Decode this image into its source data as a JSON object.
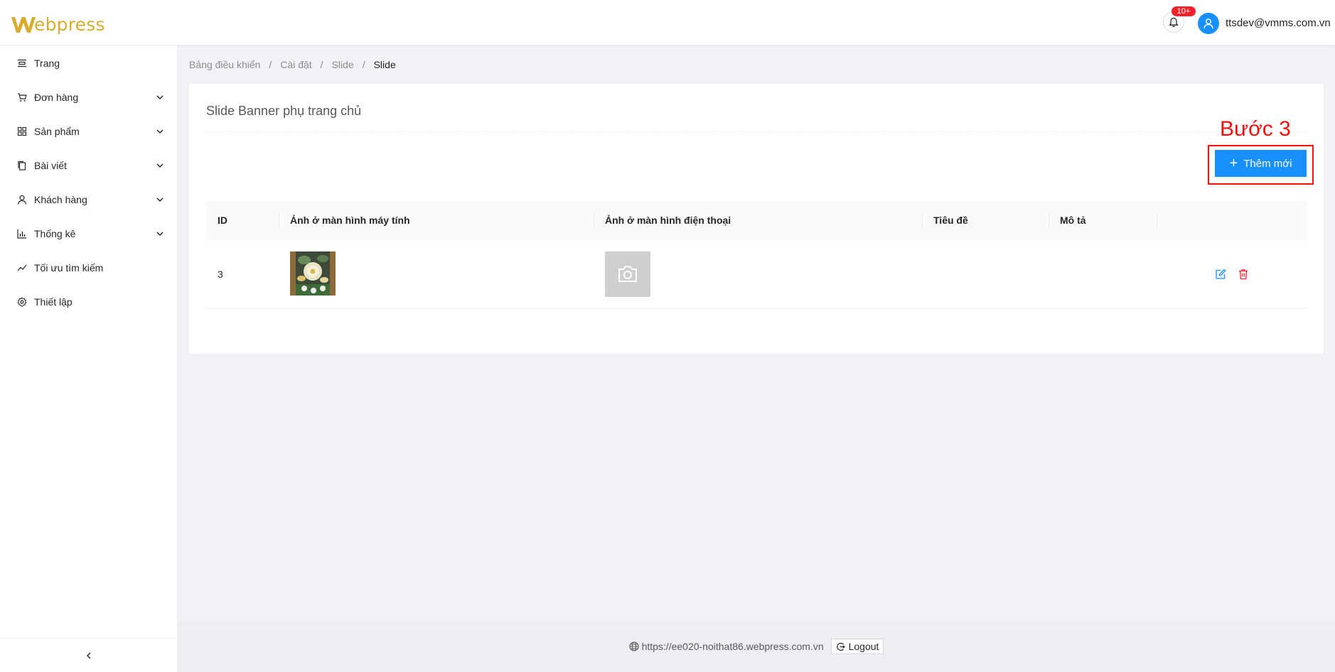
{
  "header": {
    "logo_text": "ebpress",
    "logo_full": "Webpress",
    "notification_badge": "10+",
    "user_email": "ttsdev@vmms.com.vn"
  },
  "sidebar": {
    "items": [
      {
        "label": "Trang",
        "icon": "pages-icon",
        "has_submenu": false
      },
      {
        "label": "Đơn hàng",
        "icon": "cart-icon",
        "has_submenu": true
      },
      {
        "label": "Sản phẩm",
        "icon": "grid-icon",
        "has_submenu": true
      },
      {
        "label": "Bài viết",
        "icon": "copy-icon",
        "has_submenu": true
      },
      {
        "label": "Khách hàng",
        "icon": "user-icon",
        "has_submenu": true
      },
      {
        "label": "Thống kê",
        "icon": "bar-chart-icon",
        "has_submenu": true
      },
      {
        "label": "Tối ưu tìm kiếm",
        "icon": "trend-icon",
        "has_submenu": false
      },
      {
        "label": "Thiết lập",
        "icon": "gear-icon",
        "has_submenu": false
      }
    ],
    "collapse_icon": "chevron-left-icon"
  },
  "breadcrumb": {
    "items": [
      "Bảng điều khiển",
      "Cài đặt",
      "Slide",
      "Slide"
    ],
    "separator": "/"
  },
  "card": {
    "title": "Slide Banner phụ trang chủ",
    "annotation": "Bước 3",
    "add_button": "Thêm mới"
  },
  "table": {
    "headers": [
      "ID",
      "Ảnh ở màn hình máy tính",
      "Ảnh ở màn hình điện thoại",
      "Tiêu đề",
      "Mô tả",
      ""
    ],
    "rows": [
      {
        "id": "3",
        "desktop_image": "flower-painting-thumbnail",
        "mobile_image": "camera-placeholder-icon",
        "title": "",
        "description": "",
        "actions": [
          "edit-icon",
          "delete-icon"
        ]
      }
    ]
  },
  "footer": {
    "url": "https://ee020-noithat86.webpress.com.vn",
    "logout_label": "Logout"
  },
  "colors": {
    "primary": "#1890ff",
    "brand_gold": "#d8ac2f",
    "annotation_red": "#f5100c",
    "delete_red": "#f5222d"
  }
}
